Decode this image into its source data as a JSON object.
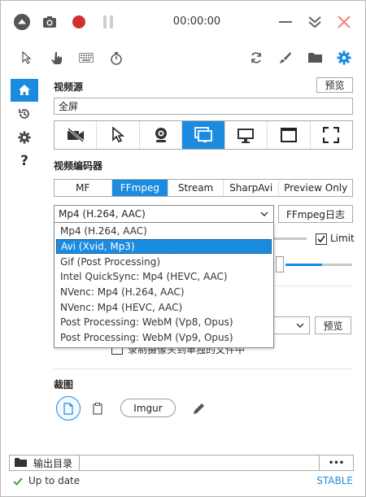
{
  "titlebar": {
    "timer": "00:00:00",
    "icons": [
      "collapse-icon",
      "screenshot-icon",
      "record-icon",
      "pause-icon",
      "minimize-icon",
      "expand-icon",
      "close-icon"
    ]
  },
  "toolbar": {
    "left_icons": [
      "cursor-icon",
      "click-hand-icon",
      "keyboard-icon",
      "stopwatch-icon"
    ],
    "right_icons": [
      "refresh-icon",
      "brush-icon",
      "folder-icon",
      "settings-icon"
    ]
  },
  "nav": [
    "home-icon",
    "history-icon",
    "gear-icon",
    "help-icon"
  ],
  "nav_help_label": "?",
  "video_source": {
    "label": "视频源",
    "preview_button": "预览",
    "value": "全屏",
    "modes": [
      "no-video-icon",
      "region-cursor-icon",
      "webcam-icon",
      "screen-icon",
      "monitor-icon",
      "window-icon",
      "fullscreen-icon"
    ],
    "active_index": 3
  },
  "encoder": {
    "label": "视频编码器",
    "tabs": [
      "MF",
      "FFmpeg",
      "Stream",
      "SharpAvi",
      "Preview Only"
    ],
    "active_tab": "FFmpeg",
    "selected": "Mp4 (H.264, AAC)",
    "log_button": "FFmpeg日志",
    "options": [
      "Mp4 (H.264, AAC)",
      "Avi (Xvid, Mp3)",
      "Gif (Post Processing)",
      "Intel QuickSync: Mp4 (HEVC, AAC)",
      "NVenc: Mp4 (H.264, AAC)",
      "NVenc: Mp4 (HEVC, AAC)",
      "Post Processing: WebM (Vp8, Opus)",
      "Post Processing: WebM (Vp9, Opus)"
    ],
    "highlighted_index": 1,
    "limit_label": "Limit",
    "limit_checked": true,
    "quality_fraction": 0.55
  },
  "webcam": {
    "preview_button": "预览",
    "separate_file_label": "录制摄像头到单独的文件中"
  },
  "crop": {
    "label": "裁图",
    "imgur_button": "Imgur"
  },
  "footer": {
    "output_label": "输出目录",
    "more_button": "•••",
    "status_text": "Up to date",
    "channel": "STABLE"
  },
  "colors": {
    "accent": "#1b8be0",
    "record": "#d03030",
    "status_ok": "#2a9d3a"
  }
}
